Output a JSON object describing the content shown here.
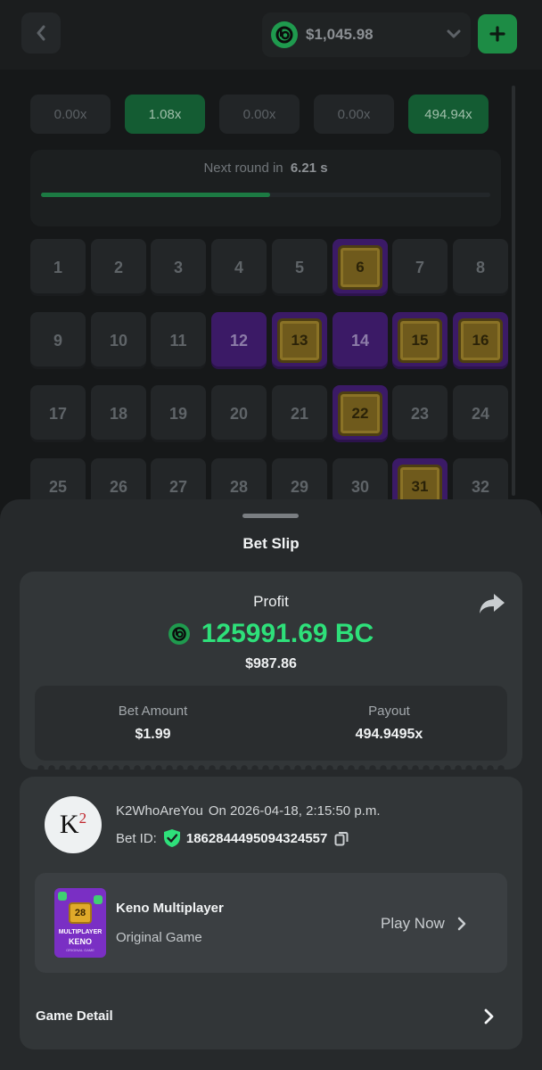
{
  "header": {
    "balance": "$1,045.98",
    "back_icon": "chevron-left-icon",
    "caret_icon": "chevron-down-icon",
    "plus_icon": "plus-icon"
  },
  "game": {
    "multipliers": [
      "0.00x",
      "1.08x",
      "0.00x",
      "0.00x",
      "494.94x"
    ],
    "next_round_label": "Next round in",
    "next_round_value": "6.21 s",
    "round_progress": 0.51,
    "tiles": [
      {
        "n": "1",
        "state": "normal"
      },
      {
        "n": "2",
        "state": "normal"
      },
      {
        "n": "3",
        "state": "normal"
      },
      {
        "n": "4",
        "state": "normal"
      },
      {
        "n": "5",
        "state": "normal"
      },
      {
        "n": "6",
        "state": "hit"
      },
      {
        "n": "7",
        "state": "normal"
      },
      {
        "n": "8",
        "state": "normal"
      },
      {
        "n": "9",
        "state": "normal"
      },
      {
        "n": "10",
        "state": "normal"
      },
      {
        "n": "11",
        "state": "normal"
      },
      {
        "n": "12",
        "state": "selected"
      },
      {
        "n": "13",
        "state": "hit"
      },
      {
        "n": "14",
        "state": "selected"
      },
      {
        "n": "15",
        "state": "hit"
      },
      {
        "n": "16",
        "state": "hit"
      },
      {
        "n": "17",
        "state": "normal"
      },
      {
        "n": "18",
        "state": "normal"
      },
      {
        "n": "19",
        "state": "normal"
      },
      {
        "n": "20",
        "state": "normal"
      },
      {
        "n": "21",
        "state": "normal"
      },
      {
        "n": "22",
        "state": "hit"
      },
      {
        "n": "23",
        "state": "normal"
      },
      {
        "n": "24",
        "state": "normal"
      },
      {
        "n": "25",
        "state": "normal"
      },
      {
        "n": "26",
        "state": "normal"
      },
      {
        "n": "27",
        "state": "normal"
      },
      {
        "n": "28",
        "state": "normal"
      },
      {
        "n": "29",
        "state": "normal"
      },
      {
        "n": "30",
        "state": "normal"
      },
      {
        "n": "31",
        "state": "hit"
      },
      {
        "n": "32",
        "state": "normal"
      }
    ]
  },
  "bet_slip": {
    "title": "Bet Slip",
    "profit_label": "Profit",
    "profit_value": "125991.69 BC",
    "profit_usd": "$987.86",
    "bet_amount_label": "Bet Amount",
    "bet_amount_value": "$1.99",
    "payout_label": "Payout",
    "payout_value": "494.9495x",
    "share_icon": "share-arrow-icon"
  },
  "bet_info": {
    "avatar_text": "K",
    "avatar_sup": "2",
    "username": "K2WhoAreYou",
    "date": "On 2026-04-18, 2:15:50 p.m.",
    "bet_id_label": "Bet ID:",
    "bet_id_value": "1862844495094324557",
    "shield_icon": "verified-shield-icon",
    "copy_icon": "copy-icon"
  },
  "game_card": {
    "thumb_number": "28",
    "thumb_line1": "MULTIPLAYER",
    "thumb_line2": "KENO",
    "thumb_line3": "ORIGINAL GAME",
    "name": "Keno Multiplayer",
    "subtitle": "Original Game",
    "play_label": "Play Now"
  },
  "game_detail": {
    "label": "Game Detail"
  },
  "colors": {
    "accent_green": "#2ee07a",
    "brand_green": "#1f9a4e",
    "purple": "#3b1a66"
  }
}
